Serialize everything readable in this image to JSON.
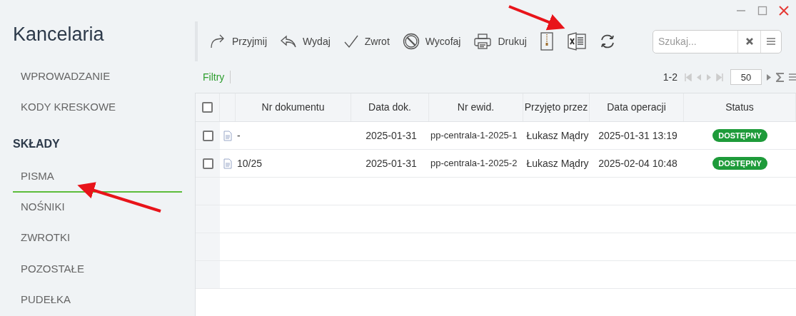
{
  "app_title": "Kancelaria",
  "sidebar": {
    "items": [
      {
        "kind": "link",
        "label": "WPROWADZANIE",
        "selected": false
      },
      {
        "kind": "link",
        "label": "KODY KRESKOWE",
        "selected": false
      },
      {
        "kind": "section",
        "label": "SKŁADY"
      },
      {
        "kind": "link",
        "label": "PISMA",
        "selected": true
      },
      {
        "kind": "link",
        "label": "NOŚNIKI",
        "selected": false
      },
      {
        "kind": "link",
        "label": "ZWROTKI",
        "selected": false
      },
      {
        "kind": "link",
        "label": "POZOSTAŁE",
        "selected": false
      },
      {
        "kind": "link",
        "label": "PUDEŁKA",
        "selected": false
      }
    ]
  },
  "toolbar": [
    {
      "kind": "redo",
      "label": "Przyjmij"
    },
    {
      "kind": "reply",
      "label": "Wydaj"
    },
    {
      "kind": "check",
      "label": "Zwrot"
    },
    {
      "kind": "ban",
      "label": "Wycofaj"
    },
    {
      "kind": "print",
      "label": "Drukuj"
    },
    {
      "kind": "zip"
    },
    {
      "kind": "excel"
    },
    {
      "kind": "refresh"
    }
  ],
  "search": {
    "placeholder": "Szukaj..."
  },
  "filters_label": "Filtry",
  "pager": {
    "range": "1-2",
    "page_size": "50"
  },
  "table": {
    "select_all_checked": false,
    "columns": [
      "Nr dokumentu",
      "Data dok.",
      "Nr ewid.",
      "Przyjęto przez",
      "Data operacji",
      "Status"
    ],
    "rows": [
      {
        "checked": false,
        "cells": [
          "-",
          "2025-01-31",
          "pp-centrala-1-2025-1",
          "Łukasz Mądry",
          "2025-01-31 13:19"
        ],
        "status": "DOSTĘPNY"
      },
      {
        "checked": false,
        "cells": [
          "10/25",
          "2025-01-31",
          "pp-centrala-1-2025-2",
          "Łukasz Mądry",
          "2025-02-04 10:48"
        ],
        "status": "DOSTĘPNY"
      }
    ]
  }
}
